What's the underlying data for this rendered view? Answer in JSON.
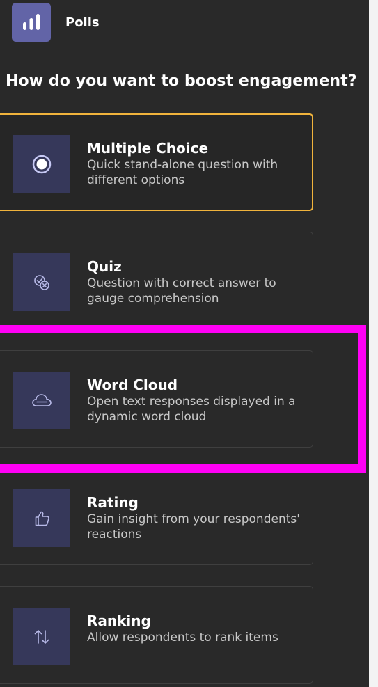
{
  "app": {
    "title": "Polls",
    "icon": "bar-chart-icon",
    "accent": "#6264a7"
  },
  "prompt": "How do you want to boost engagement?",
  "options": [
    {
      "title": "Multiple Choice",
      "description": "Quick stand-alone question with different options",
      "icon": "radio-button-icon",
      "selected": true
    },
    {
      "title": "Quiz",
      "description": "Question with correct answer to gauge comprehension",
      "icon": "check-x-icon",
      "selected": false
    },
    {
      "title": "Word Cloud",
      "description": "Open text responses displayed in a dynamic word cloud",
      "icon": "cloud-icon",
      "selected": false,
      "highlighted": true
    },
    {
      "title": "Rating",
      "description": "Gain insight from your respondents' reactions",
      "icon": "thumbs-up-icon",
      "selected": false
    },
    {
      "title": "Ranking",
      "description": "Allow respondents to rank items",
      "icon": "sort-arrows-icon",
      "selected": false
    }
  ],
  "colors": {
    "selected_border": "#f0b33c",
    "highlight": "#ff00f5",
    "icon_tile": "#36385a"
  }
}
